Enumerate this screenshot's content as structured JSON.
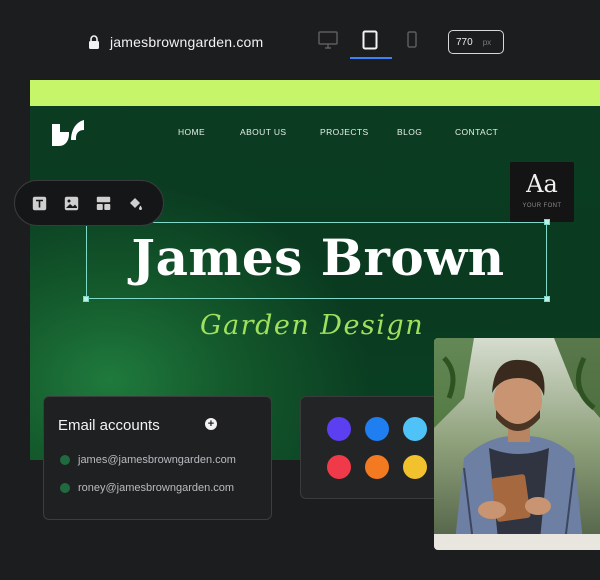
{
  "browser": {
    "url": "jamesbrowngarden.com",
    "width_value": "770",
    "width_unit": "px",
    "devices": [
      "desktop-icon",
      "tablet-icon",
      "mobile-icon"
    ],
    "active_device": "tablet-icon"
  },
  "site": {
    "nav": [
      "HOME",
      "ABOUT US",
      "PROJECTS",
      "BLOG",
      "CONTACT"
    ],
    "title": "James Brown",
    "subtitle": "Garden Design",
    "font_card": {
      "sample": "Aa",
      "label": "YOUR FONT"
    },
    "colors": {
      "accent_lime": "#c6f56a",
      "background_green": "#0b3d22",
      "script_green": "#9fe05e"
    }
  },
  "toolbar": {
    "tools": [
      "text-icon",
      "image-icon",
      "layout-icon",
      "paint-bucket-icon"
    ]
  },
  "email_card": {
    "heading": "Email accounts",
    "add_label": "+",
    "accounts": [
      "james@jamesbrowngarden.com",
      "roney@jamesbrowngarden.com"
    ]
  },
  "palette": {
    "colors": [
      "#5b3ff0",
      "#1f7ef0",
      "#4fc3f7",
      "#117a4f",
      "#f03a4a",
      "#f47a22",
      "#f2c12e",
      "#ffffff"
    ]
  }
}
